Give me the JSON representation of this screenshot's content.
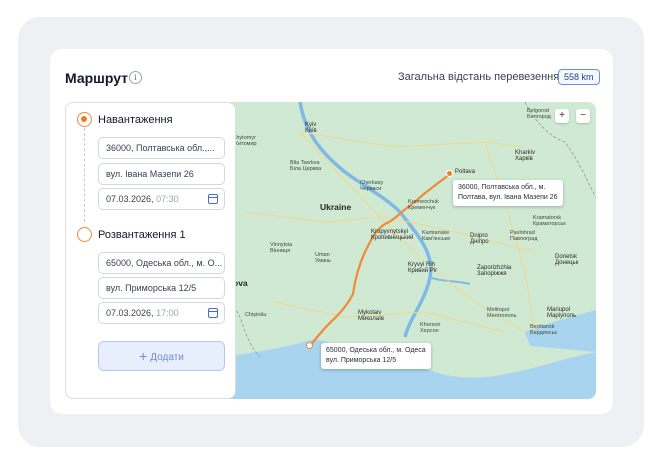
{
  "header": {
    "title": "Маршрут",
    "info_icon": "i",
    "distance_label": "Загальна відстань перевезення",
    "distance_value": "558 km"
  },
  "route": {
    "loading": {
      "title": "Навантаження",
      "address_line1": "36000, Полтавська обл.,...",
      "address_line2": "вул. Івана Мазепи 26",
      "date": "07.03.2026,",
      "time": "07:30"
    },
    "unloading": {
      "title": "Розвантаження 1",
      "address_line1": "65000, Одеська обл., м. О...",
      "address_line2": "вул. Приморська 12/5",
      "date": "07.03.2026,",
      "time": "17:00"
    },
    "add_button": "Додати"
  },
  "map": {
    "zoom_in": "+",
    "zoom_out": "−",
    "tooltip_start_line1": "36000, Полтавська обл., м.",
    "tooltip_start_line2": "Полтава, вул. Івана Мазепи 26",
    "tooltip_end_line1": "65000, Одеська обл., м. Одеса",
    "tooltip_end_line2": "вул. Приморська 12/5",
    "labels": {
      "belgorod": "Belgorod\nБелгород",
      "kyiv": "Kyiv\nКиїв",
      "zhytomyr": "Zhytomyr\nЖитомир",
      "kharkiv": "Kharkiv\nХарків",
      "poltava": "Poltava",
      "ukraine": "Ukraine",
      "bila": "Bila Tserkva\nБіла Церква",
      "cherkasy": "Cherkasy\nЧеркаси",
      "kremenchuk": "Kremenchuk\nКременчук",
      "kropyvnytskyi": "Kropyvnytskyi\nКропивницький",
      "kamianske": "Kamianske\nКам'янське",
      "dnipro": "Dnipro\nДніпро",
      "pavlohrad": "Pavlohrad\nПавлоград",
      "kramatorsk": "Kramatorsk\nКраматорськ",
      "kryvyi": "Kryvyi Rih\nКривий Ріг",
      "zaporizhzhia": "Zaporizhzhia\nЗапоріжжя",
      "donetsk": "Donetsk\nДонецьк",
      "mykolaiv": "Mykolaiv\nМиколаїв",
      "kherson": "Kherson\nХерсон",
      "mariupol": "Mariupol\nМаріуполь",
      "berdyansk": "Berdiansk\nБердянськ",
      "chisinau": "Chișinău",
      "ova": "ova",
      "uman": "Uman\nУмань",
      "vinnytsia": "Vinnytsia\nВінниця",
      "melitopol": "Melitopol\nМелітополь"
    }
  },
  "colors": {
    "accent": "#f07a20",
    "route": "#f08a3a",
    "map_land": "#cfe9d3",
    "water": "#a8d4f0",
    "add_button": "#e8effc"
  }
}
